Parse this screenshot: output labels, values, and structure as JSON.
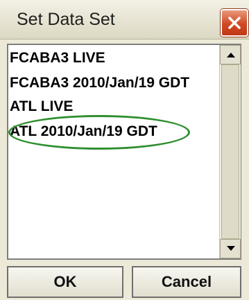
{
  "dialog": {
    "title": "Set Data Set",
    "close_icon": "close-icon",
    "accent_color": "#d24e27"
  },
  "list": {
    "items": [
      {
        "label": "FCABA3 LIVE"
      },
      {
        "label": "FCABA3 2010/Jan/19 GDT"
      },
      {
        "label": "ATL LIVE"
      },
      {
        "label": "ATL 2010/Jan/19 GDT"
      }
    ],
    "highlight_color": "#2f8f2f"
  },
  "scrollbar": {
    "up_icon": "arrow-up-icon",
    "down_icon": "arrow-down-icon"
  },
  "buttons": {
    "ok_label": "OK",
    "cancel_label": "Cancel"
  }
}
